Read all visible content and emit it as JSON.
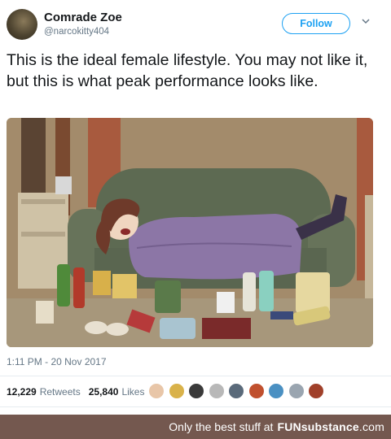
{
  "tweet": {
    "display_name": "Comrade Zoe",
    "handle": "@narcokitty404",
    "follow_label": "Follow",
    "text": "This is the ideal female lifestyle. You may not like it, but this is what peak performance looks like.",
    "timestamp": "1:11 PM - 20 Nov 2017",
    "retweets_count": "12,229",
    "retweets_label": "Retweets",
    "likes_count": "25,840",
    "likes_label": "Likes",
    "liker_avatar_colors": [
      "#e8c6a8",
      "#d9b24a",
      "#3a3a3a",
      "#b8b8b8",
      "#5a6a7a",
      "#c0502e",
      "#4a90c2",
      "#9aa5b0",
      "#a0402a"
    ]
  },
  "footer": {
    "prefix": "Only the best stuff at",
    "brand": "FUNsubstance",
    "tld": ".com"
  },
  "colors": {
    "accent": "#1da1f2",
    "footer_bg": "#74584f"
  },
  "icons": {
    "chevron": "chevron-down-icon"
  }
}
